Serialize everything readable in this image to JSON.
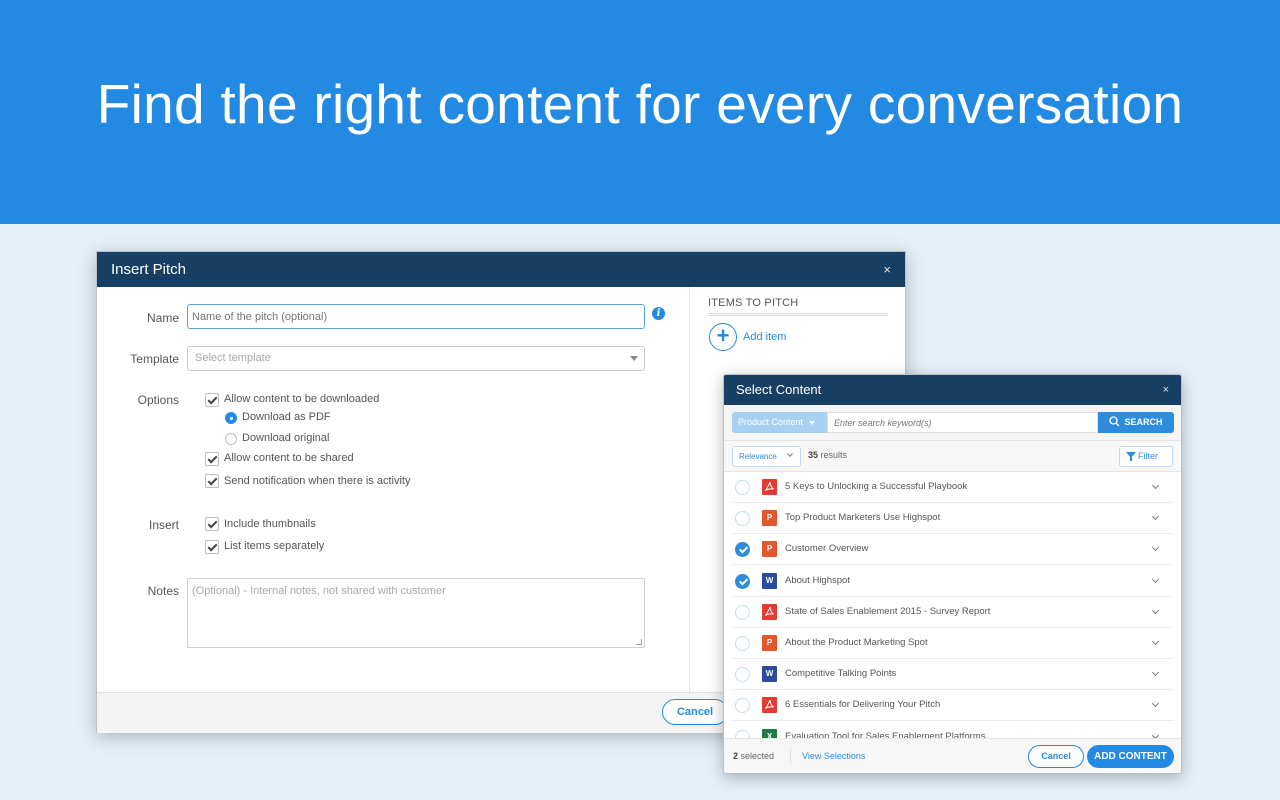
{
  "hero": {
    "headline": "Find the right content for every conversation"
  },
  "insert_pitch": {
    "title": "Insert Pitch",
    "close": "×",
    "name_label": "Name",
    "name_placeholder": "Name of the pitch (optional)",
    "name_value": "",
    "info_icon": "i",
    "template_label": "Template",
    "template_value": "Select template",
    "options_label": "Options",
    "options": {
      "allow_download": {
        "label": "Allow content to be downloaded",
        "checked": true
      },
      "download_pdf": {
        "label": "Download as PDF",
        "selected": true
      },
      "download_original": {
        "label": "Download original",
        "selected": false
      },
      "allow_shared": {
        "label": "Allow content to be shared",
        "checked": true
      },
      "send_notification": {
        "label": "Send notification when there is activity",
        "checked": true
      }
    },
    "insert_label": "Insert",
    "insert": {
      "include_thumbnails": {
        "label": "Include thumbnails",
        "checked": true
      },
      "list_separately": {
        "label": "List items separately",
        "checked": true
      }
    },
    "notes_label": "Notes",
    "notes_placeholder": "(Optional) - Internal notes, not shared with customer",
    "items_title": "ITEMS TO PITCH",
    "add_item_icon": "+",
    "add_item": "Add item",
    "cancel": "Cancel"
  },
  "select_content": {
    "title": "Select Content",
    "close": "×",
    "scope": "Product Content",
    "search_placeholder": "Enter search keyword(s)",
    "search_button": "SEARCH",
    "sort": "Relevance",
    "results_count": "35",
    "results_label": "results",
    "filter": "Filter",
    "items": [
      {
        "title": "5 Keys to Unlocking a Successful Playbook",
        "type": "pdf",
        "icon": "",
        "selected": false
      },
      {
        "title": "Top Product Marketers Use Highspot",
        "type": "ppt",
        "icon": "P",
        "selected": false
      },
      {
        "title": "Customer Overview",
        "type": "ppt",
        "icon": "P",
        "selected": true
      },
      {
        "title": "About Highspot",
        "type": "doc",
        "icon": "W",
        "selected": true
      },
      {
        "title": "State of Sales Enablement 2015 - Survey Report",
        "type": "pdf",
        "icon": "",
        "selected": false
      },
      {
        "title": "About the Product Marketing Spot",
        "type": "ppt",
        "icon": "P",
        "selected": false
      },
      {
        "title": "Competitive Talking Points",
        "type": "doc",
        "icon": "W",
        "selected": false
      },
      {
        "title": "6 Essentials for Delivering Your Pitch",
        "type": "pdf",
        "icon": "",
        "selected": false
      },
      {
        "title": "Evaluation Tool for Sales Enablement Platforms",
        "type": "xls",
        "icon": "X",
        "selected": false
      }
    ],
    "selected_count": "2",
    "selected_label": "selected",
    "view_selections": "View Selections",
    "cancel": "Cancel",
    "add_content": "ADD CONTENT"
  }
}
